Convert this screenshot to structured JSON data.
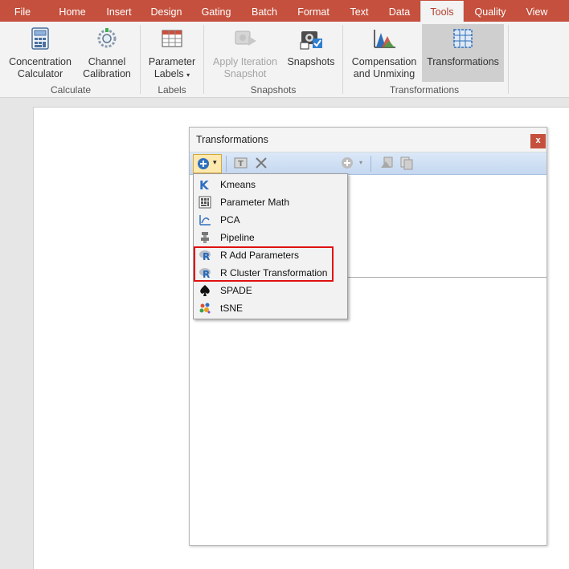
{
  "tabs": [
    "File",
    "Home",
    "Insert",
    "Design",
    "Gating",
    "Batch",
    "Format",
    "Text",
    "Data",
    "Tools",
    "Quality",
    "View"
  ],
  "active_tab": "Tools",
  "ribbon": {
    "concentration_line1": "Concentration",
    "concentration_line2": "Calculator",
    "channel_line1": "Channel",
    "channel_line2": "Calibration",
    "group_calculate": "Calculate",
    "parameter_line1": "Parameter",
    "parameter_line2": "Labels",
    "group_labels": "Labels",
    "apply_line1": "Apply Iteration",
    "apply_line2": "Snapshot",
    "snapshots_label": "Snapshots",
    "group_snapshots": "Snapshots",
    "comp_line1": "Compensation",
    "comp_line2": "and Unmixing",
    "transformations_label": "Transformations",
    "group_transformations": "Transformations"
  },
  "panel": {
    "title": "Transformations",
    "close_label": "x"
  },
  "menu": {
    "items": [
      {
        "label": "Kmeans",
        "icon": "kmeans-icon"
      },
      {
        "label": "Parameter Math",
        "icon": "calculator-grid-icon"
      },
      {
        "label": "PCA",
        "icon": "pca-icon"
      },
      {
        "label": "Pipeline",
        "icon": "pipeline-icon"
      },
      {
        "label": "R Add Parameters",
        "icon": "r-logo-icon"
      },
      {
        "label": "R Cluster Transformation",
        "icon": "r-logo-icon"
      },
      {
        "label": "SPADE",
        "icon": "spade-icon"
      },
      {
        "label": "tSNE",
        "icon": "tsne-icon"
      }
    ]
  },
  "colors": {
    "accent": "#c4503d",
    "ribbon_bg": "#f3f3f3",
    "highlight_box": "#e01010",
    "toolbar_blue": "#c5d8f0"
  }
}
